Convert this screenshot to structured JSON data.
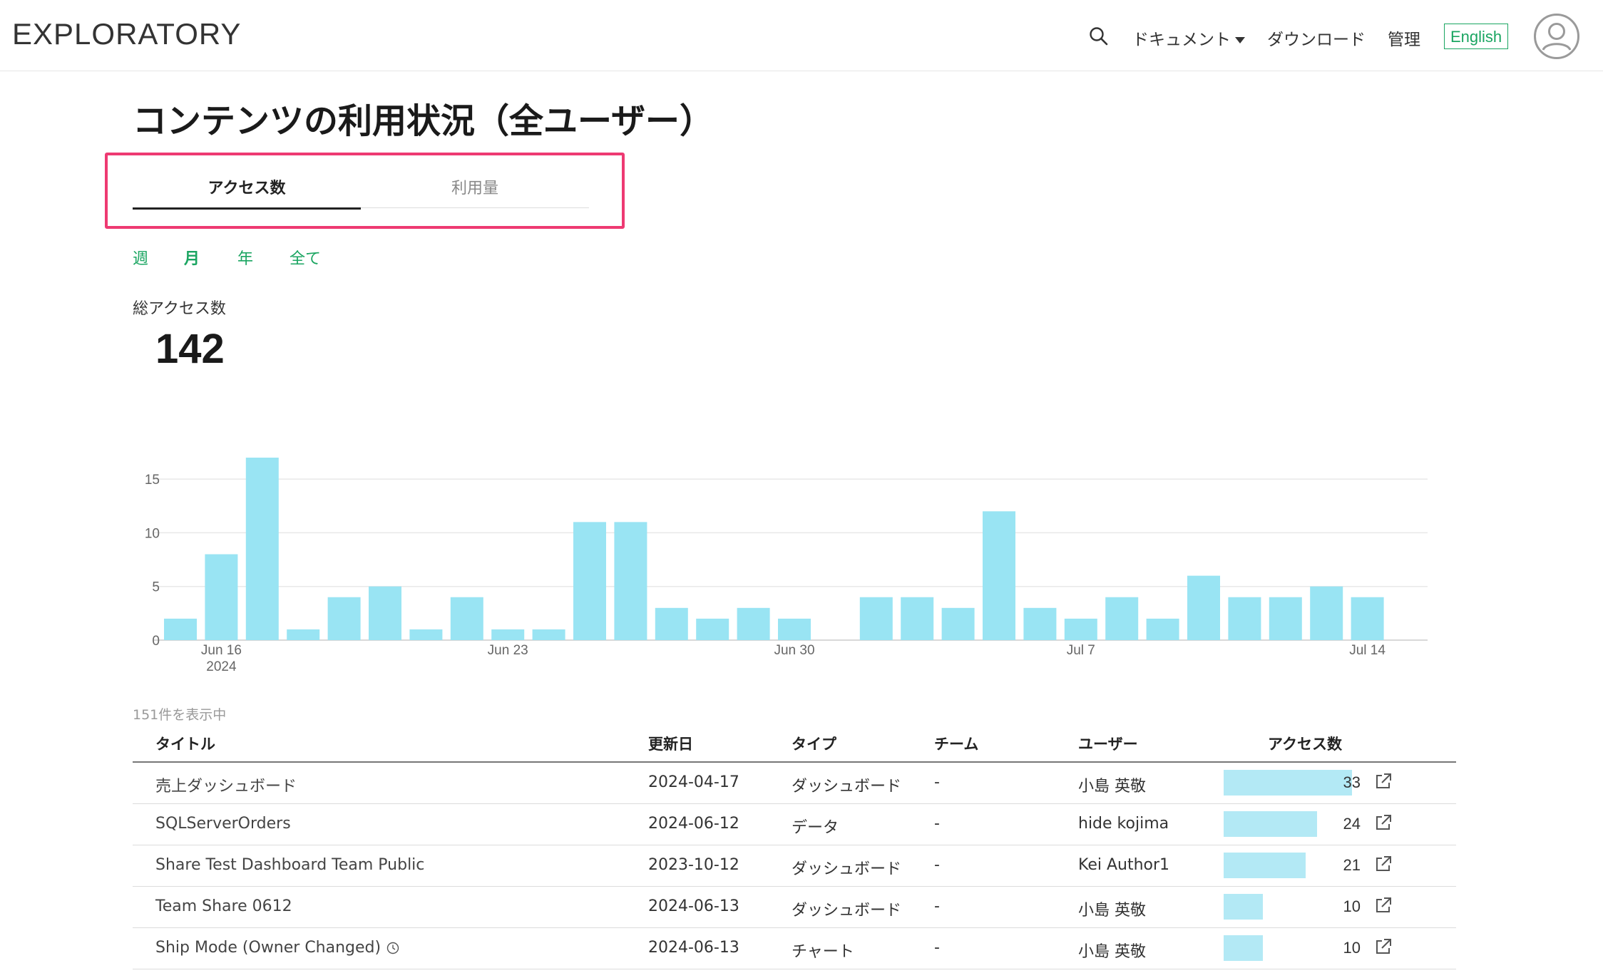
{
  "header": {
    "logo": "EXPLORATORY",
    "nav": {
      "docs": "ドキュメント",
      "download": "ダウンロード",
      "admin": "管理",
      "language": "English"
    },
    "accent_color": "#1aa561"
  },
  "page": {
    "title": "コンテンツの利用状況（全ユーザー）",
    "tabs": [
      {
        "label": "アクセス数",
        "active": true
      },
      {
        "label": "利用量",
        "active": false
      }
    ],
    "periods": [
      {
        "label": "週",
        "active": false
      },
      {
        "label": "月",
        "active": true
      },
      {
        "label": "年",
        "active": false
      },
      {
        "label": "全て",
        "active": false
      }
    ],
    "total_label": "総アクセス数",
    "total_value": "142"
  },
  "chart_data": {
    "type": "bar",
    "x": [
      "2024-06-15",
      "2024-06-16",
      "2024-06-17",
      "2024-06-18",
      "2024-06-19",
      "2024-06-20",
      "2024-06-21",
      "2024-06-22",
      "2024-06-23",
      "2024-06-24",
      "2024-06-25",
      "2024-06-26",
      "2024-06-27",
      "2024-06-28",
      "2024-06-29",
      "2024-06-30",
      "2024-07-01",
      "2024-07-02",
      "2024-07-03",
      "2024-07-04",
      "2024-07-05",
      "2024-07-06",
      "2024-07-07",
      "2024-07-08",
      "2024-07-09",
      "2024-07-10",
      "2024-07-11",
      "2024-07-12",
      "2024-07-13",
      "2024-07-14"
    ],
    "values": [
      2,
      8,
      17,
      1,
      4,
      5,
      1,
      4,
      1,
      1,
      11,
      11,
      3,
      2,
      3,
      2,
      0,
      4,
      4,
      3,
      12,
      3,
      2,
      4,
      2,
      6,
      4,
      4,
      5,
      4
    ],
    "x_tick_labels": [
      {
        "date": "2024-06-16",
        "label": "Jun 16",
        "sublabel": "2024"
      },
      {
        "date": "2024-06-23",
        "label": "Jun 23",
        "sublabel": ""
      },
      {
        "date": "2024-06-30",
        "label": "Jun 30",
        "sublabel": ""
      },
      {
        "date": "2024-07-07",
        "label": "Jul 7",
        "sublabel": ""
      },
      {
        "date": "2024-07-14",
        "label": "Jul 14",
        "sublabel": ""
      }
    ],
    "y_ticks": [
      0,
      5,
      10,
      15
    ],
    "ylim": [
      0,
      17
    ],
    "bar_color": "#99e4f3",
    "grid": true
  },
  "table": {
    "count_label": "151件を表示中",
    "headers": {
      "title": "タイトル",
      "updated": "更新日",
      "type": "タイプ",
      "team": "チーム",
      "user": "ユーザー",
      "access": "アクセス数"
    },
    "max_access": 33,
    "rows": [
      {
        "title": "売上ダッシュボード",
        "updated": "2024-04-17",
        "type": "ダッシュボード",
        "team": "-",
        "user": "小島 英敬",
        "access": 33,
        "clock": false
      },
      {
        "title": "SQLServerOrders",
        "updated": "2024-06-12",
        "type": "データ",
        "team": "-",
        "user": "hide kojima",
        "access": 24,
        "clock": false
      },
      {
        "title": "Share Test Dashboard Team Public",
        "updated": "2023-10-12",
        "type": "ダッシュボード",
        "team": "-",
        "user": "Kei Author1",
        "access": 21,
        "clock": false
      },
      {
        "title": "Team Share 0612",
        "updated": "2024-06-13",
        "type": "ダッシュボード",
        "team": "-",
        "user": "小島 英敬",
        "access": 10,
        "clock": false
      },
      {
        "title": "Ship Mode (Owner Changed)",
        "updated": "2024-06-13",
        "type": "チャート",
        "team": "-",
        "user": "小島 英敬",
        "access": 10,
        "clock": true
      }
    ]
  }
}
